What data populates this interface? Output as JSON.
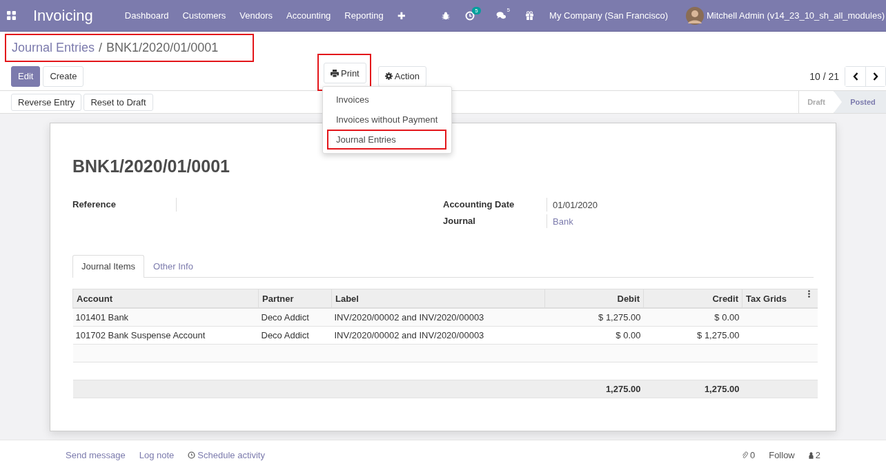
{
  "navbar": {
    "app_name": "Invoicing",
    "menu": [
      "Dashboard",
      "Customers",
      "Vendors",
      "Accounting",
      "Reporting"
    ],
    "plus": "✚",
    "activity_count": "5",
    "message_count": "5",
    "company": "My Company (San Francisco)",
    "user": "Mitchell Admin (v14_23_10_sh_all_modules)"
  },
  "breadcrumb": {
    "parent": "Journal Entries",
    "separator": "/",
    "current": "BNK1/2020/01/0001",
    "highlighted": true
  },
  "buttons": [
    {
      "label": "Edit",
      "kind": "primary"
    },
    {
      "label": "Create",
      "kind": "secondary"
    }
  ],
  "print": {
    "label": "Print",
    "highlighted": true,
    "items": [
      {
        "label": "Invoices",
        "highlighted": false
      },
      {
        "label": "Invoices without Payment",
        "highlighted": false
      },
      {
        "label": "Journal Entries",
        "highlighted": true
      }
    ]
  },
  "action": {
    "label": "Action"
  },
  "pager": {
    "value": "10 / 21"
  },
  "header_buttons": [
    "Reverse Entry",
    "Reset to Draft"
  ],
  "status": [
    {
      "label": "Draft",
      "selected": false
    },
    {
      "label": "Posted",
      "selected": true
    }
  ],
  "sheet": {
    "title": "BNK1/2020/01/0001",
    "left_fields": [
      {
        "label": "Reference"
      }
    ],
    "right_fields": [
      {
        "label": "Accounting Date",
        "value": "01/01/2020",
        "kind": "text"
      },
      {
        "label": "Journal",
        "value": "Bank",
        "kind": "link"
      }
    ],
    "tabs": [
      {
        "label": "Journal Items",
        "selected": true
      },
      {
        "label": "Other Info",
        "selected": false
      }
    ],
    "table": {
      "columns": [
        "Account",
        "Partner",
        "Label",
        "Debit",
        "Credit",
        "Tax Grids"
      ],
      "rows": [
        [
          "101401 Bank",
          "Deco Addict",
          "INV/2020/00002 and INV/2020/00003",
          "$ 1,275.00",
          "$ 0.00"
        ],
        [
          "101702 Bank Suspense Account",
          "Deco Addict",
          "INV/2020/00002 and INV/2020/00003",
          "$ 0.00",
          "$ 1,275.00"
        ]
      ],
      "totals": {
        "debit": "1,275.00",
        "credit": "1,275.00"
      }
    }
  },
  "chatter": {
    "actions": [
      "Send message",
      "Log note",
      "Schedule activity"
    ],
    "attachments": "0",
    "follow": "Follow",
    "followers": "2"
  }
}
